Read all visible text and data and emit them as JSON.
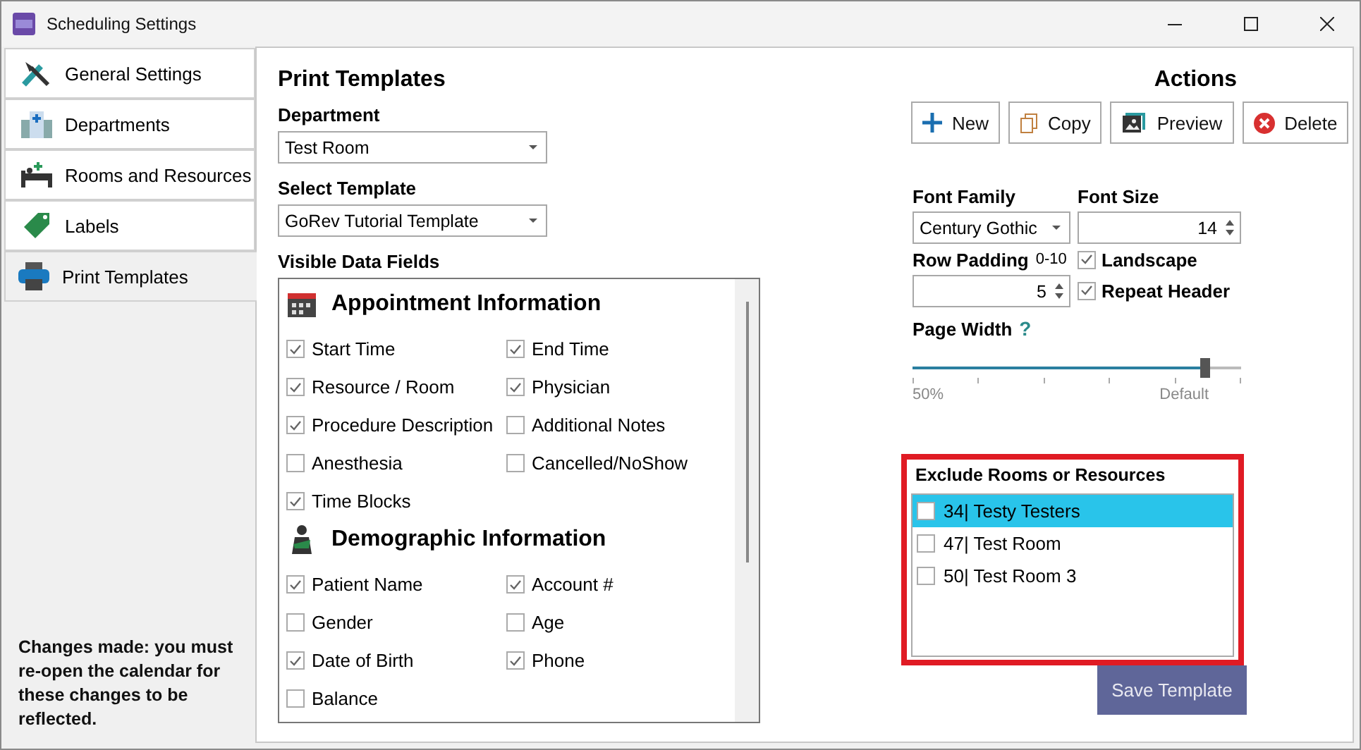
{
  "window": {
    "title": "Scheduling Settings"
  },
  "sidebar": {
    "items": [
      {
        "label": "General Settings",
        "kind": "tools",
        "selected": false
      },
      {
        "label": "Departments",
        "kind": "building",
        "selected": false
      },
      {
        "label": "Rooms and Resources",
        "kind": "bed",
        "selected": false
      },
      {
        "label": "Labels",
        "kind": "tag",
        "selected": false
      },
      {
        "label": "Print Templates",
        "kind": "printer",
        "selected": true
      }
    ],
    "note": "Changes made: you must re-open the calendar for these changes to be reflected."
  },
  "main": {
    "title": "Print Templates",
    "department": {
      "label": "Department",
      "value": "Test Room"
    },
    "template": {
      "label": "Select Template",
      "value": "GoRev Tutorial Template"
    },
    "fields_label": "Visible Data Fields",
    "sections": [
      {
        "title": "Appointment Information",
        "kind": "calendar",
        "fields": [
          {
            "label": "Start Time",
            "checked": true
          },
          {
            "label": "End Time",
            "checked": true
          },
          {
            "label": "Resource / Room",
            "checked": true
          },
          {
            "label": "Physician",
            "checked": true
          },
          {
            "label": "Procedure Description",
            "checked": true
          },
          {
            "label": "Additional Notes",
            "checked": false
          },
          {
            "label": "Anesthesia",
            "checked": false
          },
          {
            "label": "Cancelled/NoShow",
            "checked": false
          },
          {
            "label": "Time Blocks",
            "checked": true
          }
        ]
      },
      {
        "title": "Demographic Information",
        "kind": "person",
        "fields": [
          {
            "label": "Patient Name",
            "checked": true
          },
          {
            "label": "Account #",
            "checked": true
          },
          {
            "label": "Gender",
            "checked": false
          },
          {
            "label": "Age",
            "checked": false
          },
          {
            "label": "Date of Birth",
            "checked": true
          },
          {
            "label": "Phone",
            "checked": true
          },
          {
            "label": "Balance",
            "checked": false
          }
        ]
      }
    ]
  },
  "actions": {
    "title": "Actions",
    "buttons": [
      {
        "label": "New",
        "kind": "plus"
      },
      {
        "label": "Copy",
        "kind": "copy"
      },
      {
        "label": "Preview",
        "kind": "preview"
      },
      {
        "label": "Delete",
        "kind": "delete"
      }
    ]
  },
  "options": {
    "font_family": {
      "label": "Font Family",
      "value": "Century Gothic"
    },
    "font_size": {
      "label": "Font Size",
      "value": "14"
    },
    "row_padding": {
      "label": "Row Padding",
      "hint": "0-10",
      "value": "5"
    },
    "landscape": {
      "label": "Landscape",
      "checked": true
    },
    "repeat_header": {
      "label": "Repeat Header",
      "checked": true
    },
    "page_width": {
      "label": "Page Width",
      "help": "?",
      "level": 0.89,
      "min_label": "50%",
      "max_label": "Default"
    }
  },
  "exclude": {
    "label": "Exclude Rooms or Resources",
    "items": [
      {
        "label": "34| Testy Testers",
        "checked": false,
        "selected": true
      },
      {
        "label": "47| Test Room",
        "checked": false,
        "selected": false
      },
      {
        "label": "50| Test Room 3",
        "checked": false,
        "selected": false
      }
    ]
  },
  "save_button": "Save Template"
}
